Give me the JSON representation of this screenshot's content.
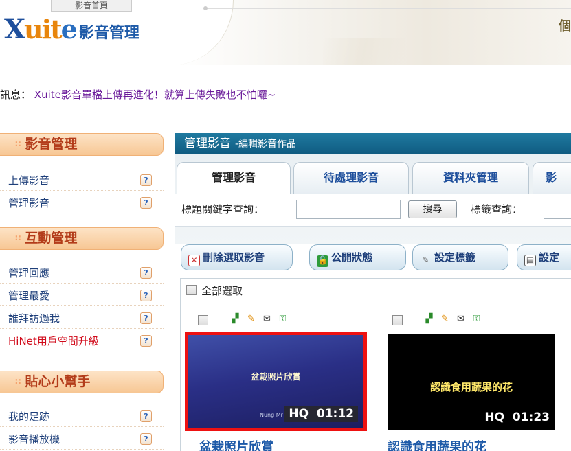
{
  "header": {
    "home_tab": "影音首頁",
    "logo_x": "X",
    "logo_uite": "uit",
    "logo_e": "e",
    "logo_sub": "影音管理",
    "right_char": "個"
  },
  "notice": {
    "label": "訊息：",
    "text": "Xuite影音單檔上傳再進化！就算上傳失敗也不怕囉~"
  },
  "sidebar": {
    "help_glyph": "?",
    "sections": [
      {
        "title": "影音管理",
        "items": [
          {
            "label": "上傳影音"
          },
          {
            "label": "管理影音"
          }
        ]
      },
      {
        "title": "互動管理",
        "items": [
          {
            "label": "管理回應"
          },
          {
            "label": "管理最愛"
          },
          {
            "label": "誰拜訪過我"
          },
          {
            "label": "HiNet用戶空間升級"
          }
        ]
      },
      {
        "title": "貼心小幫手",
        "items": [
          {
            "label": "我的足跡"
          },
          {
            "label": "影音播放機"
          }
        ]
      }
    ]
  },
  "main": {
    "bar_title": "管理影音",
    "bar_sub": "-編輯影音作品",
    "tabs": [
      {
        "label": "管理影音",
        "active": true
      },
      {
        "label": "待處理影音",
        "active": false
      },
      {
        "label": "資料夾管理",
        "active": false
      },
      {
        "label": "影",
        "active": false
      }
    ],
    "search": {
      "keyword_label": "標題關鍵字查詢：",
      "keyword_value": "",
      "search_button": "搜尋",
      "tag_label": "標籤查詢：",
      "tag_value": ""
    },
    "toolbar": {
      "delete": "刪除選取影音",
      "public": "公開狀態",
      "tag": "設定標籤",
      "set": "設定"
    },
    "select_all": "全部選取",
    "videos": [
      {
        "thumb_text": "盆栽照片欣賞",
        "credit": "Nung Mr",
        "quality": "HQ",
        "duration": "01:12",
        "title": "盆栽照片欣賞",
        "selected": true
      },
      {
        "thumb_text": "認識食用蔬果的花",
        "quality": "HQ",
        "duration": "01:23",
        "title": "認識食用蔬果的花",
        "selected": false
      }
    ]
  },
  "colors": {
    "accent_bar": "#1f7aa0",
    "sidebar_head": "#f7c794",
    "selected_border": "#e11111",
    "link": "#1e3f7a"
  }
}
